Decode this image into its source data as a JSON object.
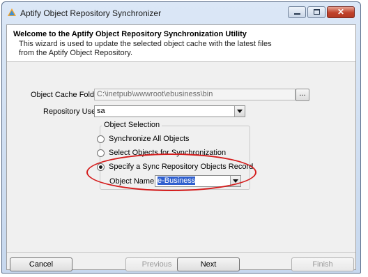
{
  "window": {
    "title": "Aptify Object Repository Synchronizer",
    "caption_buttons": {
      "minimize": "minimize-icon",
      "maximize": "maximize-icon",
      "close": "✕"
    }
  },
  "header": {
    "title": "Welcome to the Aptify Object Repository Synchronization Utility",
    "description": "This wizard is used to update the selected object cache with the latest files from the Aptify Object Repository."
  },
  "form": {
    "cache_folder_label": "Object Cache Folder",
    "cache_folder_value": "C:\\inetpub\\wwwroot\\ebusiness\\bin",
    "browse_label": "...",
    "repo_user_label": "Repository User",
    "repo_user_value": "sa"
  },
  "selection": {
    "group_title": "Object Selection",
    "options": [
      {
        "label": "Synchronize All Objects",
        "checked": false
      },
      {
        "label": "Select Objects for Synchronization",
        "checked": false
      },
      {
        "label": "Specify a Sync Repository Objects Record",
        "checked": true
      }
    ],
    "object_name_label": "Object Name",
    "object_name_value": "e-Business"
  },
  "footer": {
    "cancel": "Cancel",
    "previous": "Previous",
    "next": "Next",
    "finish": "Finish"
  },
  "colors": {
    "annotation": "#d41c1c",
    "selection_highlight": "#2f5fce"
  }
}
